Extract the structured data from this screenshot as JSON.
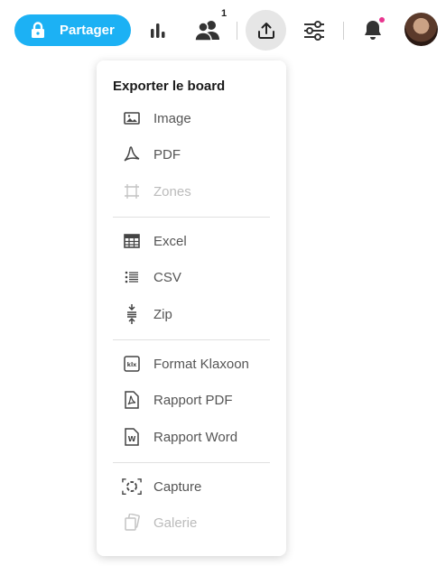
{
  "toolbar": {
    "share_label": "Partager",
    "participants_count": "1",
    "accent_color": "#1cb1f4",
    "notification_dot_color": "#e8368f"
  },
  "menu": {
    "title": "Exporter le board",
    "groups": [
      [
        {
          "label": "Image",
          "icon": "image-icon",
          "disabled": false
        },
        {
          "label": "PDF",
          "icon": "pdf-icon",
          "disabled": false
        },
        {
          "label": "Zones",
          "icon": "zones-icon",
          "disabled": true
        }
      ],
      [
        {
          "label": "Excel",
          "icon": "table-icon",
          "disabled": false
        },
        {
          "label": "CSV",
          "icon": "list-icon",
          "disabled": false
        },
        {
          "label": "Zip",
          "icon": "zip-icon",
          "disabled": false
        }
      ],
      [
        {
          "label": "Format Klaxoon",
          "icon": "klx-icon",
          "disabled": false
        },
        {
          "label": "Rapport PDF",
          "icon": "pdf-document-icon",
          "disabled": false
        },
        {
          "label": "Rapport Word",
          "icon": "word-document-icon",
          "disabled": false
        }
      ],
      [
        {
          "label": "Capture",
          "icon": "capture-icon",
          "disabled": false
        },
        {
          "label": "Galerie",
          "icon": "gallery-icon",
          "disabled": true
        }
      ]
    ]
  }
}
